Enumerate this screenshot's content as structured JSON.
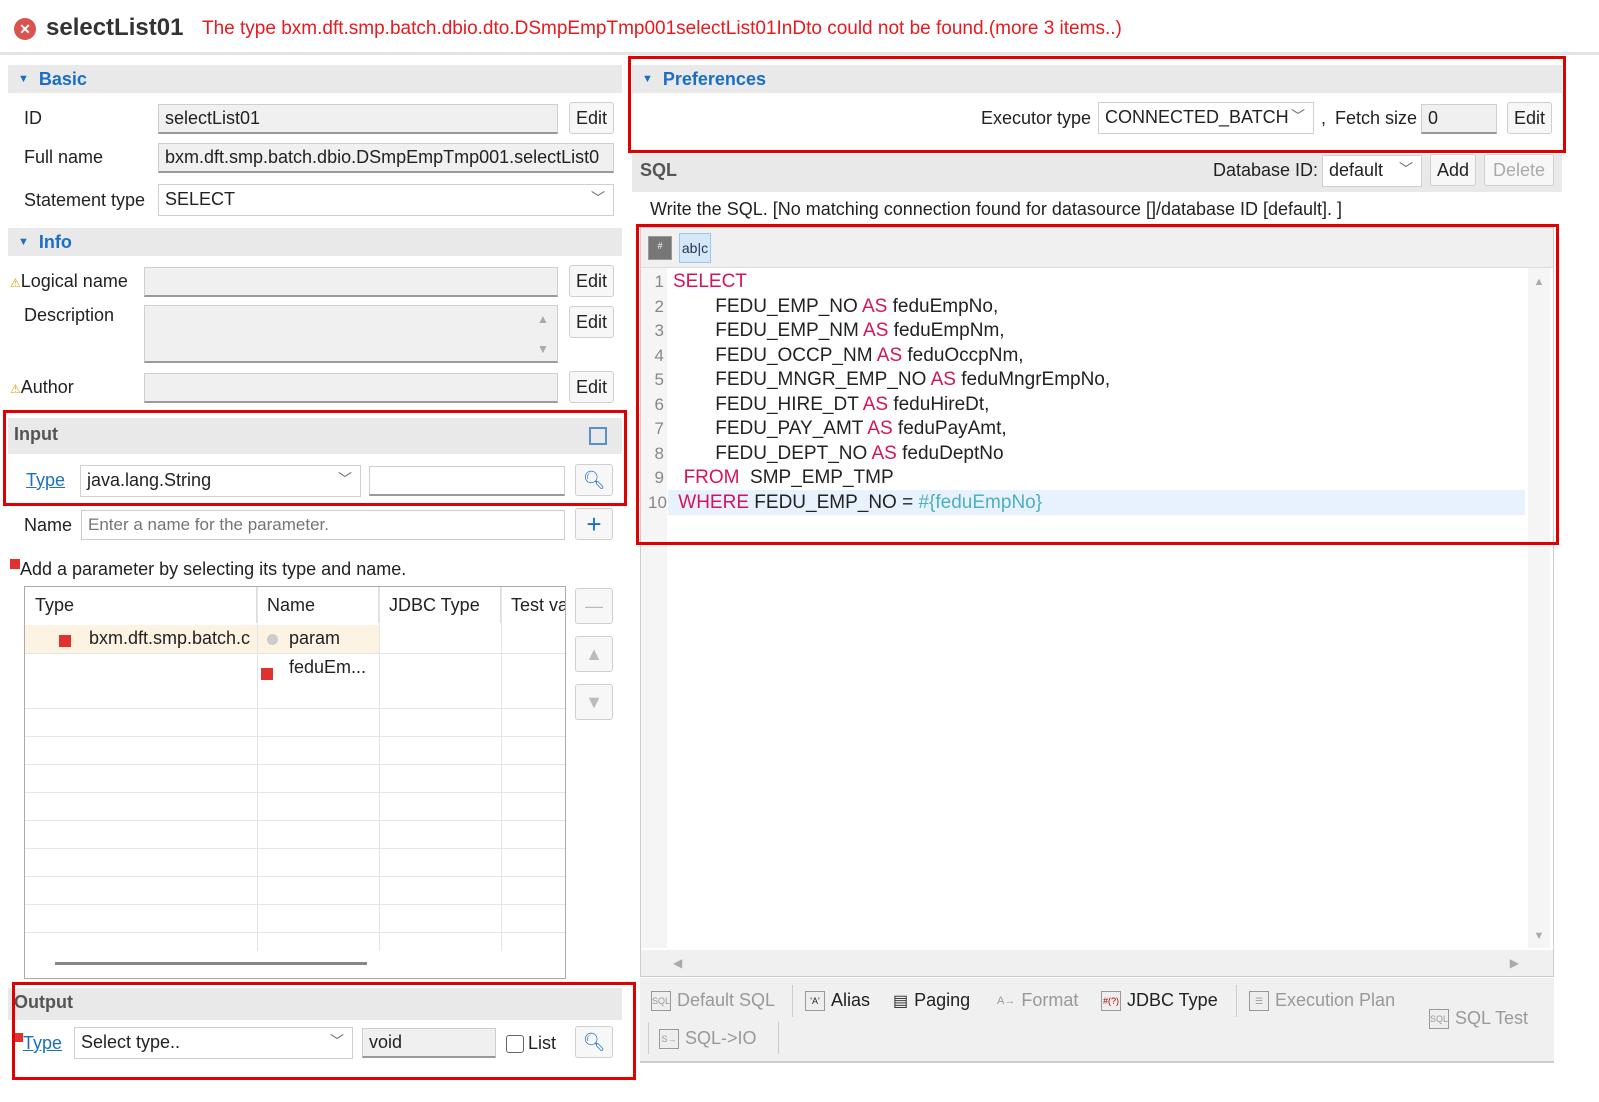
{
  "header": {
    "title": "selectList01",
    "error": "The type bxm.dft.smp.batch.dbio.dto.DSmpEmpTmp001selectList01InDto could not be found.(more 3 items..)"
  },
  "basic": {
    "section": "Basic",
    "id_label": "ID",
    "id_value": "selectList01",
    "full_name_label": "Full name",
    "full_name_value": "bxm.dft.smp.batch.dbio.DSmpEmpTmp001.selectList0",
    "statement_type_label": "Statement type",
    "statement_type_value": "SELECT",
    "edit": "Edit"
  },
  "info": {
    "section": "Info",
    "logical_name_label": "Logical name",
    "description_label": "Description",
    "author_label": "Author",
    "edit": "Edit"
  },
  "input": {
    "section": "Input",
    "type_link": "Type",
    "type_value": "java.lang.String",
    "name_label": "Name",
    "name_placeholder": "Enter a name for the parameter.",
    "hint": "Add a parameter by selecting its type and name.",
    "columns": [
      "Type",
      "Name",
      "JDBC Type",
      "Test va"
    ],
    "rows": [
      {
        "type": "bxm.dft.smp.batch.c",
        "name": "param"
      },
      {
        "type": "",
        "name": "feduEm..."
      }
    ]
  },
  "output": {
    "section": "Output",
    "type_link": "Type",
    "type_placeholder": "Select type..",
    "type_value": "void",
    "list_label": "List"
  },
  "preferences": {
    "section": "Preferences",
    "executor_label": "Executor type",
    "executor_value": "CONNECTED_BATCH",
    "sep": ",",
    "fetch_label": "Fetch size",
    "fetch_value": "0",
    "edit": "Edit"
  },
  "sql": {
    "section": "SQL",
    "database_label": "Database ID:",
    "database_value": "default",
    "add": "Add",
    "delete": "Delete",
    "message": "Write the SQL. [No matching connection found for datasource []/database ID [default]. ]",
    "lines": [
      [
        {
          "t": "SELECT",
          "k": "kw"
        }
      ],
      [
        {
          "t": "        FEDU_EMP_NO "
        },
        {
          "t": "AS",
          "k": "kw"
        },
        {
          "t": " feduEmpNo,"
        }
      ],
      [
        {
          "t": "        FEDU_EMP_NM "
        },
        {
          "t": "AS",
          "k": "kw"
        },
        {
          "t": " feduEmpNm,"
        }
      ],
      [
        {
          "t": "        FEDU_OCCP_NM "
        },
        {
          "t": "AS",
          "k": "kw"
        },
        {
          "t": " feduOccpNm,"
        }
      ],
      [
        {
          "t": "        FEDU_MNGR_EMP_NO "
        },
        {
          "t": "AS",
          "k": "kw"
        },
        {
          "t": " feduMngrEmpNo,"
        }
      ],
      [
        {
          "t": "        FEDU_HIRE_DT "
        },
        {
          "t": "AS",
          "k": "kw"
        },
        {
          "t": " feduHireDt,"
        }
      ],
      [
        {
          "t": "        FEDU_PAY_AMT "
        },
        {
          "t": "AS",
          "k": "kw"
        },
        {
          "t": " feduPayAmt,"
        }
      ],
      [
        {
          "t": "        FEDU_DEPT_NO "
        },
        {
          "t": "AS",
          "k": "kw"
        },
        {
          "t": " feduDeptNo"
        }
      ],
      [
        {
          "t": "  "
        },
        {
          "t": "FROM",
          "k": "kw"
        },
        {
          "t": "  SMP_EMP_TMP"
        }
      ],
      [
        {
          "t": " "
        },
        {
          "t": "WHERE",
          "k": "kw"
        },
        {
          "t": " FEDU_EMP_NO = "
        },
        {
          "t": "#{feduEmpNo}",
          "k": "par"
        }
      ]
    ]
  },
  "toolbar": {
    "default_sql": "Default SQL",
    "alias": "Alias",
    "paging": "Paging",
    "format": "Format",
    "jdbc_type": "JDBC Type",
    "execution_plan": "Execution Plan",
    "sql_test": "SQL Test",
    "sql_io": "SQL->IO"
  }
}
